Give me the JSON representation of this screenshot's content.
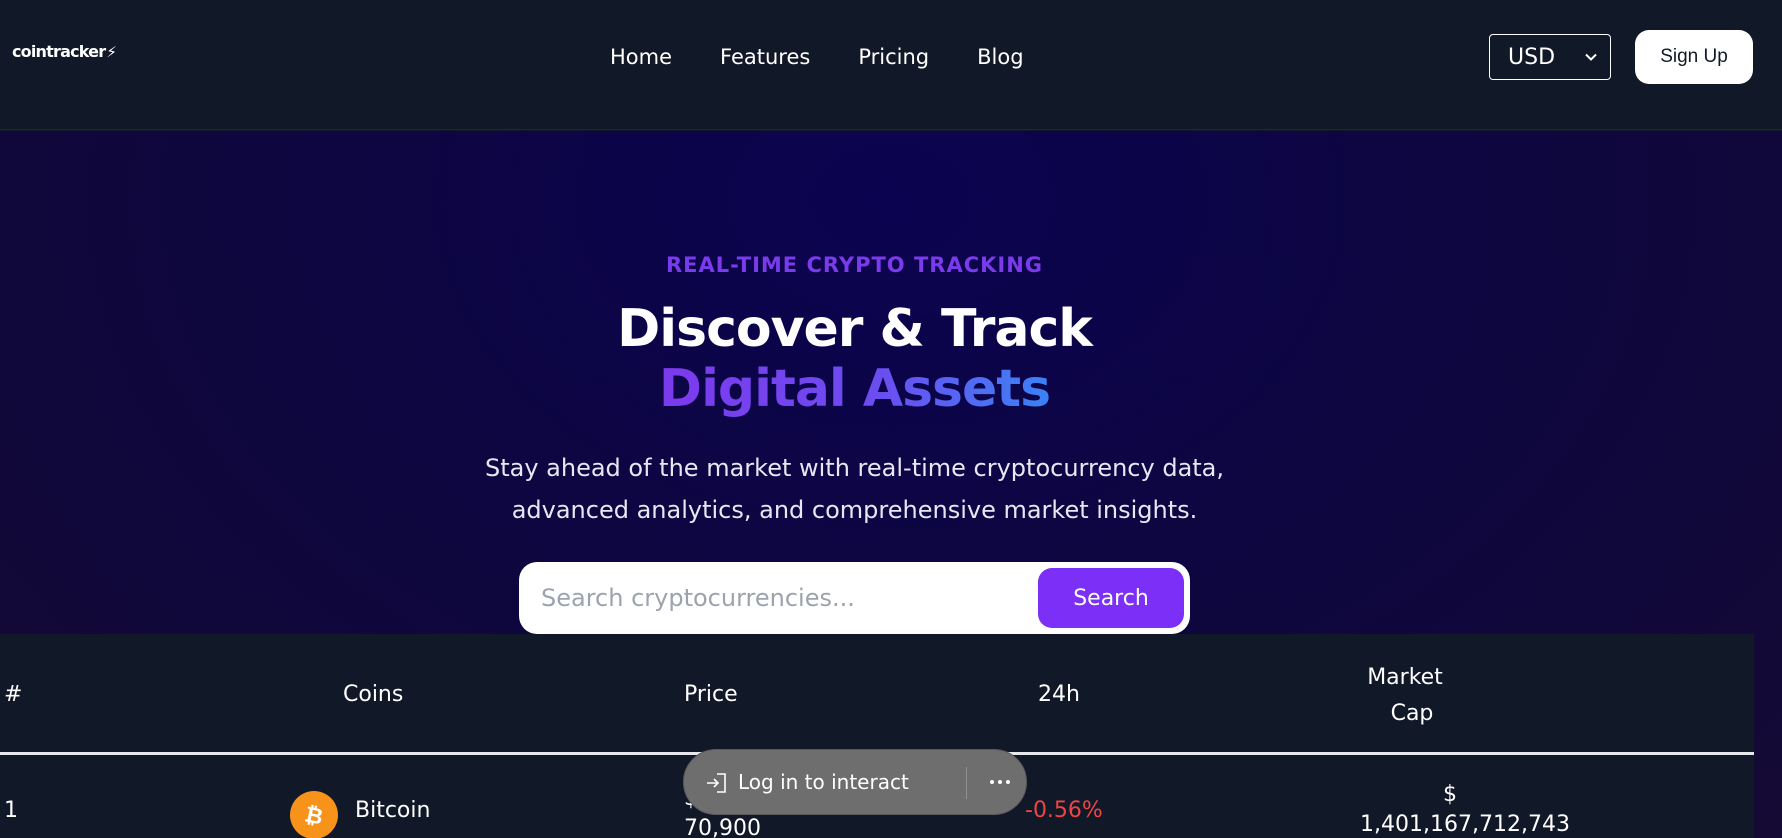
{
  "header": {
    "logo": "cointracker",
    "logo_mark": "⚡",
    "nav": [
      "Home",
      "Features",
      "Pricing",
      "Blog"
    ],
    "currency": "USD",
    "signup_label": "Sign Up"
  },
  "hero": {
    "eyebrow": "REAL-TIME CRYPTO TRACKING",
    "title_line1": "Discover & Track",
    "title_line2": "Digital Assets",
    "subtitle_line1": "Stay ahead of the market with real-time cryptocurrency data,",
    "subtitle_line2": "advanced analytics, and comprehensive market insights.",
    "search_placeholder": "Search cryptocurrencies...",
    "search_button": "Search"
  },
  "table": {
    "headers": {
      "rank": "#",
      "coins": "Coins",
      "price": "Price",
      "change": "24h",
      "market_cap_line1": "Market",
      "market_cap_line2": "Cap"
    },
    "rows": [
      {
        "rank": "1",
        "name": "Bitcoin",
        "price_symbol": "$",
        "price": "70,900",
        "change": "-0.56%",
        "market_cap_symbol": "$",
        "market_cap": "1,401,167,712,743"
      }
    ]
  },
  "toast": {
    "label": "Log in to interact"
  },
  "colors": {
    "accent": "#7b2ff7",
    "negative": "#ef4444",
    "bitcoin": "#f7931a"
  }
}
